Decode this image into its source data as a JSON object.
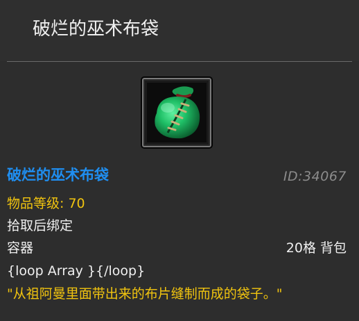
{
  "header": {
    "title": "破烂的巫术布袋"
  },
  "item": {
    "icon": "green-cloth-bag-icon",
    "name": "破烂的巫术布袋",
    "id_text": "ID:34067",
    "level_text": "物品等级: 70",
    "bind_text": "拾取后绑定",
    "type_text": "容器",
    "slots_text": "20格 背包",
    "loop_text": "{loop Array }{/loop}",
    "description": "\"从祖阿曼里面带出来的布片缝制而成的袋子。\""
  },
  "colors": {
    "background": "#2d2d2d",
    "name": "#1f8ef0",
    "level_and_description": "#f1c40f",
    "id": "#8c8c8c",
    "text": "#f0f0f0"
  }
}
